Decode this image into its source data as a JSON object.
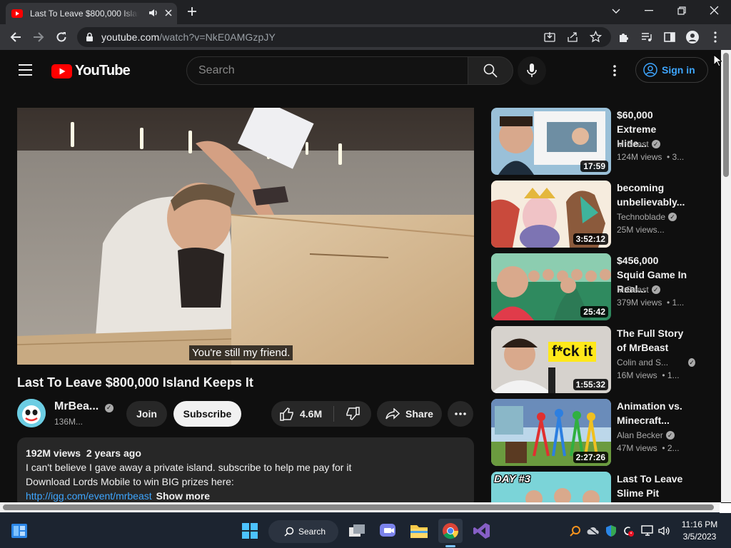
{
  "browser": {
    "tab_title": "Last To Leave $800,000 Island Keeps It",
    "url_host": "youtube.com",
    "url_path": "/watch?v=NkE0AMGzpJY"
  },
  "header": {
    "logo_text": "YouTube",
    "search_placeholder": "Search",
    "signin_label": "Sign in"
  },
  "video": {
    "caption": "You're still my friend.",
    "title": "Last To Leave $800,000 Island Keeps It",
    "channel": "MrBea...",
    "subscribers": "136M...",
    "join_label": "Join",
    "subscribe_label": "Subscribe",
    "likes": "4.6M",
    "share_label": "Share"
  },
  "description": {
    "meta": "192M views  2 years ago",
    "line1": "I can't believe I gave away a private island. subscribe to help me pay for it",
    "line2": "Download Lords Mobile to win BIG prizes here:",
    "link": "http://igg.com/event/mrbeast",
    "show_more": "Show more"
  },
  "related": [
    {
      "title": "$60,000 Extreme Hide...",
      "channel": "MrBeast",
      "views": "124M views  • 3...",
      "duration": "17:59",
      "verified": true
    },
    {
      "title": "becoming unbelievably...",
      "channel": "Technoblade",
      "views": "25M views...",
      "duration": "3:52:12",
      "verified": true
    },
    {
      "title": "$456,000 Squid Game In Real...",
      "channel": "MrBeast",
      "views": "379M views  • 1...",
      "duration": "25:42",
      "verified": true
    },
    {
      "title": "The Full Story of MrBeast",
      "channel": "Colin and S...",
      "views": "16M views  • 1...",
      "duration": "1:55:32",
      "verified": true
    },
    {
      "title": "Animation vs. Minecraft...",
      "channel": "Alan Becker",
      "views": "47M views  • 2...",
      "duration": "2:27:26",
      "verified": true
    },
    {
      "title": "Last To Leave Slime Pit Win...",
      "channel": "",
      "views": "",
      "duration": "",
      "verified": false
    }
  ],
  "thumb_texts": {
    "fck": "f*ck it",
    "day3": "DAY #3"
  },
  "taskbar": {
    "search_label": "Search",
    "time": "11:16 PM",
    "date": "3/5/2023"
  },
  "colors": {
    "brand_red": "#ff0000",
    "link_blue": "#3ea6ff",
    "page_bg": "#0f0f0f"
  }
}
